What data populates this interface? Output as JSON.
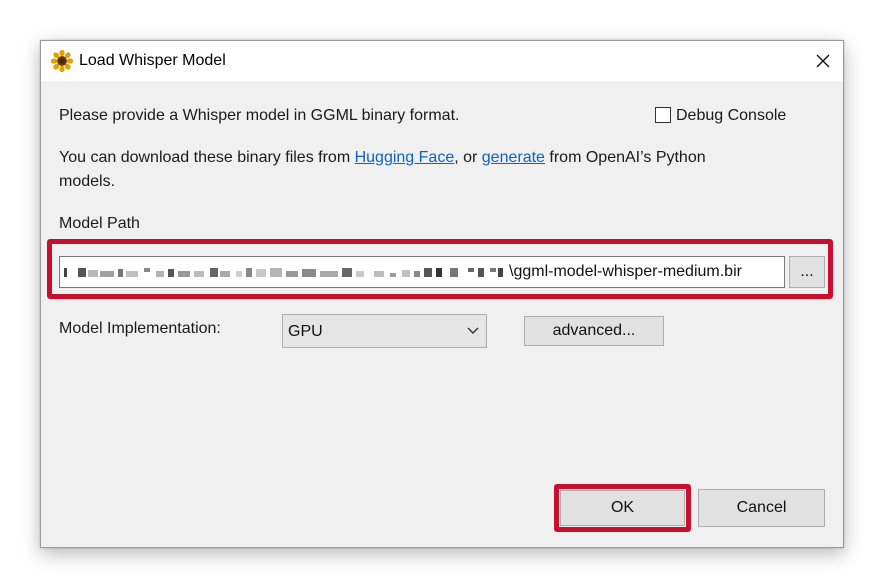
{
  "window": {
    "title": "Load Whisper Model",
    "icon": "sunflower-icon"
  },
  "intro_text": "Please provide a Whisper model in GGML binary format.",
  "debug_console": {
    "label": "Debug Console",
    "checked": false
  },
  "download_text": {
    "part1": "You can download these binary files from ",
    "link1": "Hugging Face",
    "part2": ", or ",
    "link2": "generate",
    "part3": " from OpenAI’s Python",
    "line2": "models."
  },
  "model_path": {
    "label": "Model Path",
    "value_visible": "\\ggml-model-whisper-medium.bir",
    "browse_label": "..."
  },
  "model_implementation": {
    "label": "Model Implementation:",
    "selected": "GPU",
    "advanced_label": "advanced..."
  },
  "buttons": {
    "ok": "OK",
    "cancel": "Cancel"
  },
  "colors": {
    "highlight": "#c8102e",
    "link": "#0b63c5",
    "dialog_bg": "#f0f0f0"
  }
}
